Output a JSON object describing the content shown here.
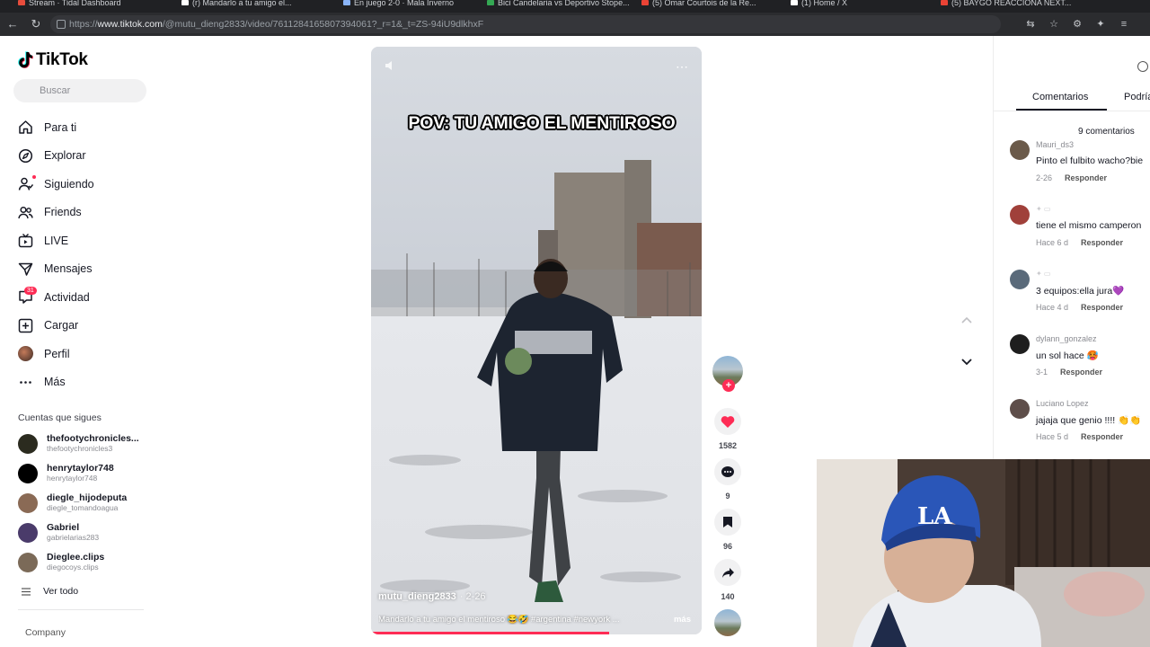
{
  "browser": {
    "tabs": [
      {
        "label": "Stream · Tidal Dashboard",
        "color": "#e74c3c"
      },
      {
        "label": "(r) Mandarlo a tu amigo el...",
        "color": "#ffffff"
      },
      {
        "label": "En juego 2-0 · Mala Inverno",
        "color": "#8ab4f8"
      },
      {
        "label": "Bici Candelaria vs Deportivo Stope...",
        "color": "#34a853"
      },
      {
        "label": "(5) Omar Courtois de la Re...",
        "color": "#ea4335"
      },
      {
        "label": "(1) Home / X",
        "color": "#ffffff"
      },
      {
        "label": "(5) BAYGO REACCIONA NEXT...",
        "color": "#ea4335"
      }
    ],
    "url_prefix": "https://",
    "url_host": "www.tiktok.com",
    "url_path": "/@mutu_dieng2833/video/7611284165807394061?_r=1&_t=ZS-94iU9dlkhxF"
  },
  "sidebar": {
    "logo": "TikTok",
    "search_placeholder": "Buscar",
    "nav": [
      {
        "label": "Para ti",
        "icon": "home-icon"
      },
      {
        "label": "Explorar",
        "icon": "compass-icon"
      },
      {
        "label": "Siguiendo",
        "icon": "user-follow-icon"
      },
      {
        "label": "Friends",
        "icon": "friends-icon"
      },
      {
        "label": "LIVE",
        "icon": "live-icon"
      },
      {
        "label": "Mensajes",
        "icon": "message-icon"
      },
      {
        "label": "Actividad",
        "icon": "activity-icon",
        "badge": "31"
      },
      {
        "label": "Cargar",
        "icon": "upload-icon"
      },
      {
        "label": "Perfil",
        "icon": "profile-avatar"
      },
      {
        "label": "Más",
        "icon": "more-icon"
      }
    ],
    "following_heading": "Cuentas que sigues",
    "following": [
      {
        "name": "thefootychronicles...",
        "handle": "thefootychronicles3",
        "color": "#2b2b1f"
      },
      {
        "name": "henrytaylor748",
        "handle": "henrytaylor748",
        "color": "#000000"
      },
      {
        "name": "diegle_hijodeputa",
        "handle": "diegle_tomandoagua",
        "color": "#8a6a55"
      },
      {
        "name": "Gabriel",
        "handle": "gabrielarias283",
        "color": "#4a3b6a"
      },
      {
        "name": "Dieglee.clips",
        "handle": "diegocoys.clips",
        "color": "#7b6a58"
      }
    ],
    "see_all": "Ver todo",
    "company": "Company"
  },
  "video": {
    "overlay_title": "POV: TU AMIGO EL MENTIROSO",
    "author": "mutu_dieng2833",
    "date": "· 2-26",
    "caption": "Mandarlo a tu amigo el mentiroso 😂🤣 #argentina #newyork ...",
    "more": "más",
    "progress": 0.72
  },
  "actions": {
    "likes": "1582",
    "comments": "9",
    "saves": "96",
    "shares": "140",
    "like_color": "#fe2c55"
  },
  "comments_panel": {
    "tabs": [
      "Comentarios",
      "Podría"
    ],
    "count_label": "9 comentarios",
    "reply_label": "Responder",
    "comments": [
      {
        "user": "Mauri_ds3",
        "text": "Pinto el fulbito wacho?bie",
        "time": "2-26",
        "color": "#6b5a4a"
      },
      {
        "user": "",
        "text": "tiene el mismo camperon",
        "time": "Hace 6 d",
        "color": "#a0403a"
      },
      {
        "user": "",
        "text": "3 equipos:ella jura💜",
        "time": "Hace 4 d",
        "color": "#5a6a7a"
      },
      {
        "user": "dylann_gonzalez",
        "text": "un sol hace 🥵",
        "time": "3-1",
        "color": "#1e1e1e"
      },
      {
        "user": "Luciano Lopez",
        "text": "jajaja que genio !!!! 👏👏",
        "time": "Hace 5 d",
        "color": "#5e4e4a"
      }
    ]
  }
}
